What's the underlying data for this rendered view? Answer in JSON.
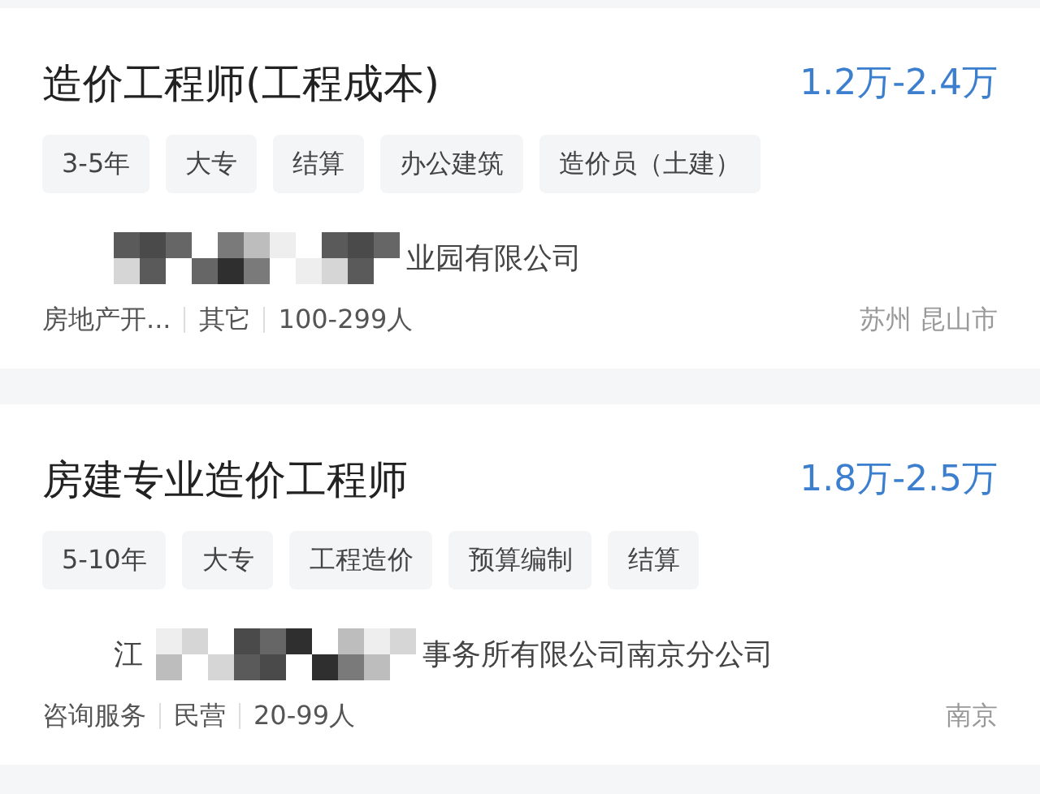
{
  "jobs": [
    {
      "title": "造价工程师(工程成本)",
      "salary": "1.2万-2.4万",
      "tags": [
        "3-5年",
        "大专",
        "结算",
        "办公建筑",
        "造价员（土建）"
      ],
      "company": {
        "tail": "业园有限公司"
      },
      "meta": [
        "房地产开...",
        "其它",
        "100-299人"
      ],
      "location": "苏州 昆山市"
    },
    {
      "title": "房建专业造价工程师",
      "salary": "1.8万-2.5万",
      "tags": [
        "5-10年",
        "大专",
        "工程造价",
        "预算编制",
        "结算"
      ],
      "company": {
        "lead": "江",
        "tail": "事务所有限公司南京分公司"
      },
      "meta": [
        "咨询服务",
        "民营",
        "20-99人"
      ],
      "location": "南京"
    }
  ]
}
